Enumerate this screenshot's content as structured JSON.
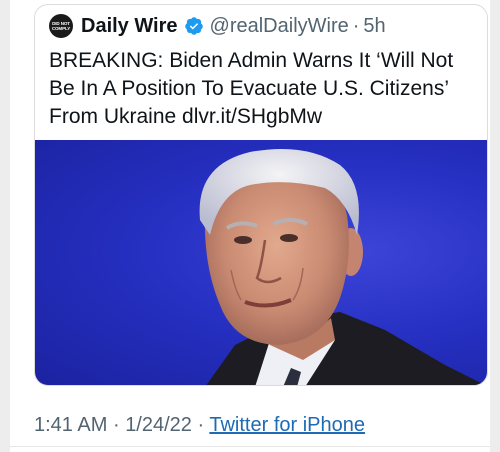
{
  "tweet": {
    "avatar_text_line1": "DID NOT",
    "avatar_text_line2": "COMPLY",
    "display_name": "Daily Wire",
    "handle": "@realDailyWire",
    "separator": "·",
    "time_ago": "5h",
    "text": "BREAKING: Biden Admin Warns It ‘Will Not Be In A Position To Evacuate U.S. Citizens’ From Ukraine dlvr.it/SHgbMw"
  },
  "meta": {
    "time": "1:41 AM",
    "date": "1/24/22",
    "separator": "·",
    "source": "Twitter for iPhone"
  },
  "colors": {
    "verified_badge": "#1d9bf0",
    "photo_background": "#2630c2",
    "link": "#1d6ab5"
  },
  "icons": {
    "verified": "verified-badge-icon"
  }
}
